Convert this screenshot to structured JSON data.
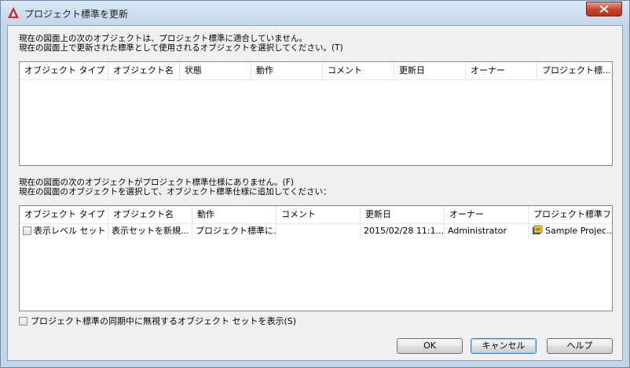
{
  "window": {
    "title": "プロジェクト標準を更新",
    "colors": {
      "title_bar": "#c3d6ea",
      "close_button": "#c7432b",
      "client_bg": "#f0f0f0",
      "app_icon": "#d7232e"
    }
  },
  "section1": {
    "message_line1": "現在の図面上の次のオブジェクトは、プロジェクト標準に適合していません。",
    "message_line2": "現在の図面上で更新された標準として使用されるオブジェクトを選択してください。(T)",
    "columns": [
      "オブジェクト タイプ",
      "オブジェクト名",
      "状態",
      "動作",
      "コメント",
      "更新日",
      "オーナー",
      "プロジェクト標..."
    ],
    "sort_column": "オブジェクト タイプ",
    "rows": []
  },
  "section2": {
    "message_line1": "現在の図面の次のオブジェクトがプロジェクト標準仕様にありません。(F)",
    "message_line2": "現在の図面のオブジェクトを選択して、オブジェクト標準仕様に追加してください：",
    "columns": [
      "オブジェクト タイプ",
      "オブジェクト名",
      "動作",
      "コメント",
      "更新日",
      "オーナー",
      "プロジェクト標準フ..."
    ],
    "sort_column": "オブジェクト タイプ",
    "rows": [
      {
        "checked": false,
        "object_type": "表示レベル セット",
        "object_name": "表示セットを新規...",
        "action": "プロジェクト標準に...",
        "comment": "",
        "modified": "2015/02/28 11:1...",
        "owner": "Administrator",
        "standards_file": "Sample Projec...",
        "standards_file_icon": "project-standards-icon"
      }
    ]
  },
  "footer": {
    "ignore_label": "プロジェクト標準の同期中に無視するオブジェクト セットを表示(S)",
    "ignore_checked": false
  },
  "buttons": {
    "ok": "OK",
    "cancel": "キャンセル",
    "help": "ヘルプ"
  }
}
